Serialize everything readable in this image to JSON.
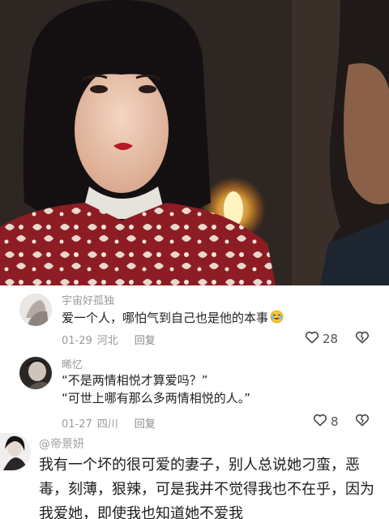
{
  "comments": [
    {
      "username": "宇宙好孤独",
      "text": "爱一个人，哪怕气到自己也是他的本事",
      "emoji": "crying-laughing-emoji",
      "date": "01-29",
      "location": "河北",
      "reply_label": "回复",
      "likes": "28"
    },
    {
      "username": "晞忆",
      "lines": [
        "“不是两情相悦才算爱吗？”",
        "“可世上哪有那么多两情相悦的人。”"
      ],
      "date": "01-27",
      "location": "四川",
      "reply_label": "回复",
      "likes": "8"
    },
    {
      "username": "@帝景妍",
      "text": "我有一个坏的很可爱的妻子，别人总说她刁蛮，恶毒，刻薄，狠辣，可是我并不觉得我也不在乎，因为我爱她，即使我也知道她不爱我"
    }
  ],
  "icons": {
    "like": "heart-outline-icon",
    "dislike": "broken-heart-outline-icon"
  }
}
